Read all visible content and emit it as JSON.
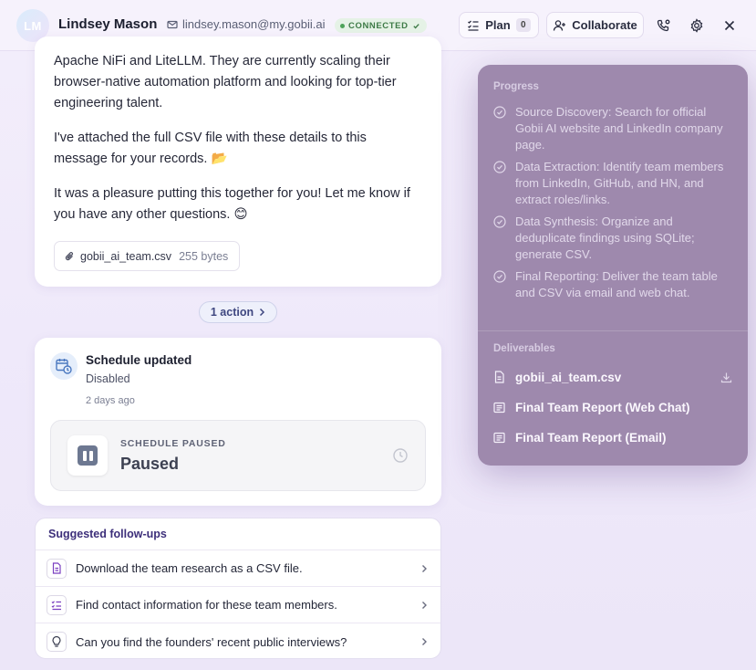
{
  "header": {
    "avatar_initials": "LM",
    "user_name": "Lindsey Mason",
    "email": "lindsey.mason@my.gobii.ai",
    "status_badge": "CONNECTED",
    "plan_label": "Plan",
    "plan_count": "0",
    "collaborate_label": "Collaborate"
  },
  "message": {
    "paragraphs": [
      "Apache NiFi and LiteLLM. They are currently scaling their browser-native automation platform and looking for top-tier engineering talent.",
      "I've attached the full CSV file with these details to this message for your records. 📂",
      "It was a pleasure putting this together for you! Let me know if you have any other questions. 😊"
    ],
    "attachment": {
      "name": "gobii_ai_team.csv",
      "size": "255 bytes"
    }
  },
  "action_pill": "1 action",
  "schedule": {
    "title": "Schedule updated",
    "status": "Disabled",
    "time": "2 days ago",
    "paused_label": "SCHEDULE PAUSED",
    "paused_value": "Paused"
  },
  "followups": {
    "title": "Suggested follow-ups",
    "items": [
      {
        "icon": "document-icon",
        "text": "Download the team research as a CSV file."
      },
      {
        "icon": "checklist-icon",
        "text": "Find contact information for these team members."
      },
      {
        "icon": "lightbulb-icon",
        "text": "Can you find the founders' recent public interviews?"
      }
    ]
  },
  "plan_panel": {
    "progress_label": "Progress",
    "progress": [
      "Source Discovery: Search for official Gobii AI website and LinkedIn company page.",
      "Data Extraction: Identify team members from LinkedIn, GitHub, and HN, and extract roles/links.",
      "Data Synthesis: Organize and deduplicate findings using SQLite; generate CSV.",
      "Final Reporting: Deliver the team table and CSV via email and web chat."
    ],
    "deliverables_label": "Deliverables",
    "deliverables": [
      {
        "icon": "file-icon",
        "label": "gobii_ai_team.csv"
      },
      {
        "icon": "message-icon",
        "label": "Final Team Report (Web Chat)"
      },
      {
        "icon": "message-icon",
        "label": "Final Team Report (Email)"
      }
    ]
  },
  "colors": {
    "panel_bg": "#9e89ad",
    "connected_green": "#4ea35a",
    "accent_purple": "#3d2f7a"
  }
}
